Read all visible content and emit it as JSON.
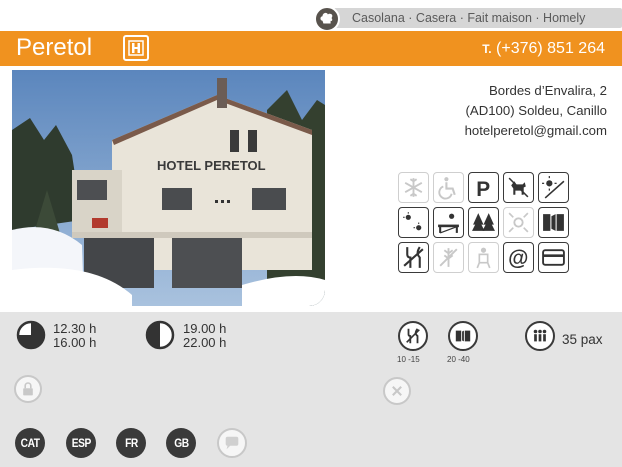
{
  "cuisine": {
    "label": "Casolana · Casera · Fait maison · Homely",
    "icon": "chef-hat-icon"
  },
  "header": {
    "name": "Peretol",
    "badge_icon": "hotel-h-icon",
    "tel_prefix": "T.",
    "tel_number": "(+376) 851 264",
    "bar_color": "#f0921f"
  },
  "photo": {
    "sign": "HOTEL PERETOL"
  },
  "address": {
    "line1": "Bordes d’Envalira, 2",
    "line2": "(AD100) Soldeu, Canillo",
    "email": "hotelperetol@gmail.com"
  },
  "services": [
    {
      "icon": "air-conditioning-icon",
      "active": false
    },
    {
      "icon": "wheelchair-access-icon",
      "active": false
    },
    {
      "icon": "parking-icon",
      "active": true
    },
    {
      "icon": "pets-allowed-icon",
      "active": true
    },
    {
      "icon": "sun-terrace-icon",
      "active": true
    },
    {
      "icon": "terrace-icon",
      "active": true
    },
    {
      "icon": "sun-bench-icon",
      "active": true
    },
    {
      "icon": "forest-icon",
      "active": true
    },
    {
      "icon": "view-icon",
      "active": false
    },
    {
      "icon": "menu-icon",
      "active": true
    },
    {
      "icon": "no-cutlery-icon",
      "active": true
    },
    {
      "icon": "gluten-free-icon",
      "active": false
    },
    {
      "icon": "baby-chair-icon",
      "active": false
    },
    {
      "icon": "email-at-icon",
      "active": true
    },
    {
      "icon": "credit-card-icon",
      "active": true
    }
  ],
  "hours": {
    "lunch_open": "12.30 h",
    "lunch_close": "16.00 h",
    "dinner_open": "19.00 h",
    "dinner_close": "22.00 h"
  },
  "prices": {
    "menu_range": "10 -15",
    "carta_range": "20 -40"
  },
  "capacity": "35 pax",
  "languages": [
    "CAT",
    "ESP",
    "FR",
    "GB"
  ]
}
